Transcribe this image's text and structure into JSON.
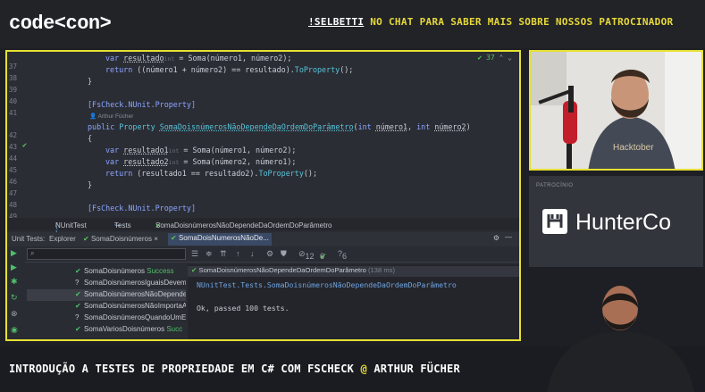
{
  "brand": {
    "logo": "code<con>"
  },
  "promo": {
    "handle": "!SELBETTI",
    "rest": " NO CHAT PARA SABER MAIS SOBRE NOSSOS PATROCINADOR"
  },
  "editor": {
    "topright": "✔ 37",
    "lines": [
      {
        "num": "37",
        "text": "var resultado"
      },
      {
        "num": "38",
        "text": "return ((número1 + número2) == resultado).ToProperty();"
      },
      {
        "num": "39",
        "text": "}"
      },
      {
        "num": "40",
        "text": ""
      },
      {
        "num": "41",
        "text": "[FsCheck.NUnit.Property]"
      },
      {
        "num": "42",
        "text": "public Property SomaDoisnúmerosNãoDependeDaOrdemDoParâmetro(int número1, int número2)"
      },
      {
        "num": "43",
        "text": "{"
      },
      {
        "num": "44",
        "text": "var resultado1"
      },
      {
        "num": "45",
        "text": "var resultado2"
      },
      {
        "num": "46",
        "text": "return (resultado1 == resultado2).ToProperty();"
      },
      {
        "num": "47",
        "text": "}"
      },
      {
        "num": "48",
        "text": ""
      },
      {
        "num": "49",
        "text": "[FsCheck.NUnit.Property]"
      }
    ],
    "line37_tail": " = Soma(número1, número2);",
    "line44_tail": " = Soma(número1, número2);",
    "line45_tail": " = Soma(número2, número1);",
    "hint_int": "int",
    "codelens_author": "Arthur Fücher"
  },
  "breadcrumb": {
    "project": "NUnitTest",
    "ns": "Tests",
    "method": "SomaDoisnúmerosNãoDependeDaOrdemDoParâmetro"
  },
  "tabs": {
    "unit_tests": "Unit Tests:",
    "explorer": "Explorer",
    "tab1": "SomaDoisnúmeros",
    "tab2": "SomaDoisNumerosNãoDe..."
  },
  "toolbar": {
    "count_total": "12",
    "count_pass": "6",
    "count_fail": "6"
  },
  "tree": [
    {
      "icon": "✔",
      "text": "SomaDoisnúmeros",
      "status": "Success",
      "selected": false
    },
    {
      "icon": "?",
      "text": "SomaDoisnúmerosIguaisDevemSe",
      "status": "",
      "selected": false
    },
    {
      "icon": "✔",
      "text": "SomaDoisnúmerosNãoDepende",
      "status": "",
      "selected": true
    },
    {
      "icon": "✔",
      "text": "SomaDoisnúmerosNãoImportaA",
      "status": "",
      "selected": false
    },
    {
      "icon": "?",
      "text": "SomaDoisnúmerosQuandoUmE",
      "status": "",
      "selected": false
    },
    {
      "icon": "✔",
      "text": "SomaVariosDoisnúmeros",
      "status": "Succ",
      "selected": false
    }
  ],
  "detail": {
    "header": "SomaDoisnúmerosNãoDependeDaOrdemDoParâmetro",
    "duration": "(138 ms)",
    "path": "NUnitTest.Tests.SomaDoisnúmerosNãoDependeDaOrdemDoParâmetro",
    "result": "Ok, passed 100 tests."
  },
  "sponsor": {
    "label": "PATROCÍNIO",
    "name": "HunterCo"
  },
  "footer": {
    "title_main": "INTRODUÇÃO A TESTES DE PROPRIEDADE EM C# COM FSCHECK ",
    "at": "@",
    "author": " ARTHUR FÜCHER"
  },
  "colors": {
    "accent_yellow": "#e6e033",
    "success_green": "#4fc06a",
    "keyword_blue": "#8aa6ff"
  }
}
